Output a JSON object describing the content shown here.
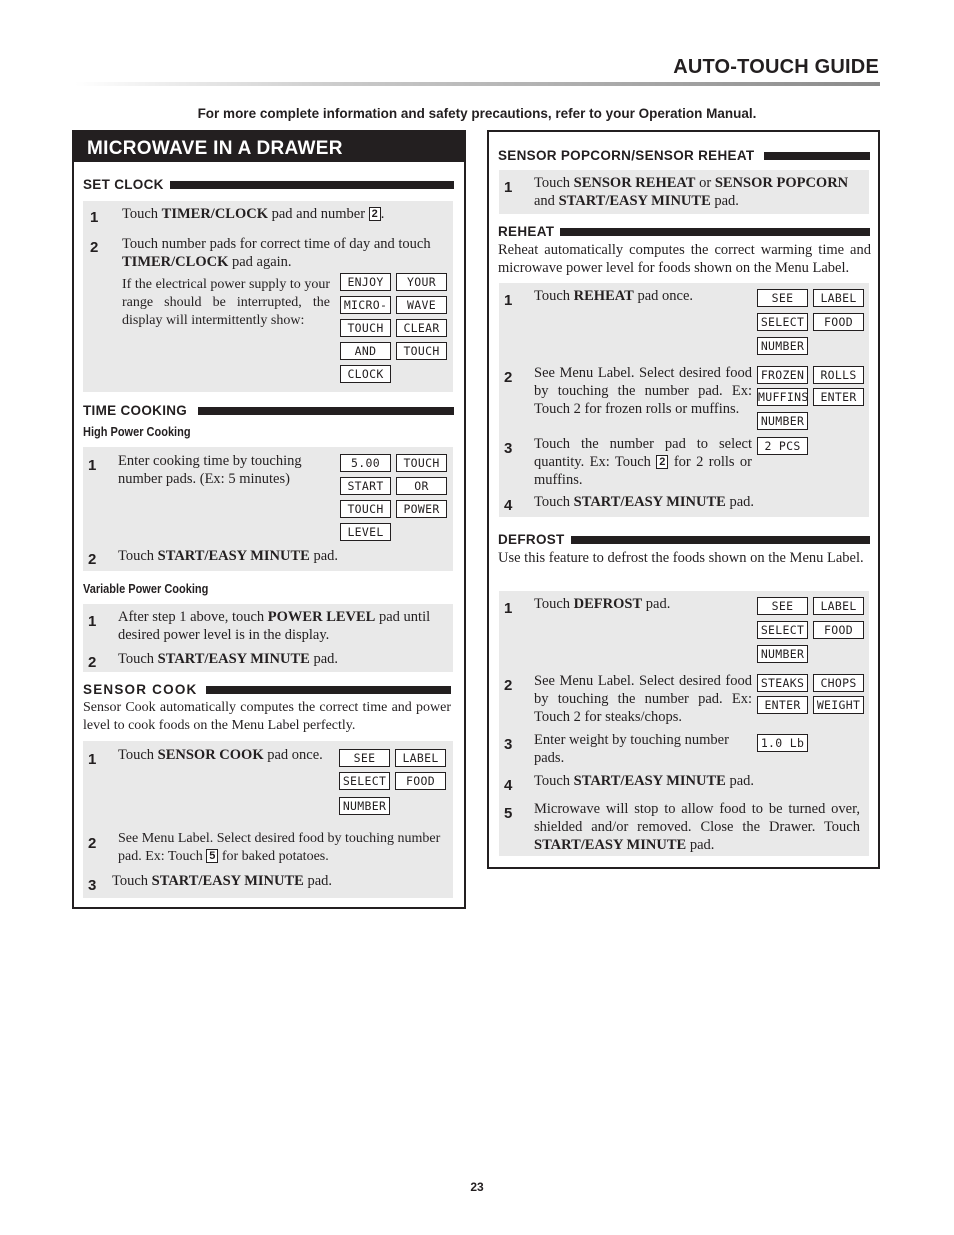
{
  "header": {
    "title": "AUTO-TOUCH GUIDE",
    "note": "For more complete information and safety precautions, refer to your Operation Manual."
  },
  "left": {
    "banner": "MICROWAVE IN A DRAWER",
    "set_clock": {
      "heading": "SET CLOCK",
      "steps": [
        {
          "num": "1",
          "pre": "Touch ",
          "bold": "TIMER/CLOCK",
          "post": " pad and number ",
          "key": "2",
          "tail": "."
        },
        {
          "num": "2",
          "pre": "Touch number pads for correct time of day and touch ",
          "bold": "TIMER/CLOCK",
          "post": " pad again."
        }
      ],
      "power_note": "If the electrical power supply to your range should be interrupted, the display will intermittently show:",
      "display": [
        "ENJOY",
        "YOUR",
        "MICRO-",
        "WAVE",
        "TOUCH",
        "CLEAR",
        "AND",
        "TOUCH",
        "CLOCK"
      ]
    },
    "time_cooking": {
      "heading": "TIME COOKING",
      "high_power": {
        "subheading": "High Power Cooking",
        "steps": [
          {
            "num": "1",
            "text": "Enter cooking time by touching number pads. (Ex: 5 minutes)"
          },
          {
            "num": "2",
            "pre": "Touch ",
            "bold": "START/EASY MINUTE",
            "post": " pad."
          }
        ],
        "display": [
          "5.00",
          "TOUCH",
          "START",
          "OR",
          "TOUCH",
          "POWER",
          "LEVEL"
        ]
      },
      "variable_power": {
        "subheading": "Variable Power Cooking",
        "steps": [
          {
            "num": "1",
            "pre": "After step 1 above, touch ",
            "bold": "POWER LEVEL",
            "post": " pad until desired power level is in the display."
          },
          {
            "num": "2",
            "pre": "Touch ",
            "bold": "START/EASY MINUTE",
            "post": " pad."
          }
        ]
      }
    },
    "sensor_cook": {
      "heading": "SENSOR COOK",
      "description": "Sensor Cook automatically computes the correct time and power level to cook foods on the Menu Label perfectly.",
      "steps": [
        {
          "num": "1",
          "pre": "Touch ",
          "bold": "SENSOR COOK",
          "post": " pad once."
        },
        {
          "num": "2",
          "pre": "See Menu Label. Select desired food by touching number pad. Ex: Touch ",
          "key": "5",
          "post": " for baked potatoes."
        },
        {
          "num": "3",
          "pre": "Touch ",
          "bold": "START/EASY MINUTE",
          "post": " pad."
        }
      ],
      "display": [
        "SEE",
        "LABEL",
        "SELECT",
        "FOOD",
        "NUMBER"
      ]
    }
  },
  "right": {
    "sensor_popcorn": {
      "heading": "SENSOR POPCORN/SENSOR REHEAT",
      "steps": [
        {
          "num": "1",
          "pre": "Touch ",
          "bold1": "SENSOR REHEAT",
          "mid": " or ",
          "bold2": "SENSOR POPCORN",
          "mid2": " and ",
          "bold3": "START/EASY MINUTE",
          "post": " pad."
        }
      ]
    },
    "reheat": {
      "heading": "REHEAT",
      "description": "Reheat automatically computes the correct warming time and microwave power level for foods shown on the Menu Label.",
      "steps": [
        {
          "num": "1",
          "pre": "Touch ",
          "bold": "REHEAT",
          "post": " pad once."
        },
        {
          "num": "2",
          "text": "See Menu Label. Select desired food by touching the number pad. Ex: Touch 2 for frozen rolls or muffins."
        },
        {
          "num": "3",
          "pre": "Touch the number pad to select quantity. Ex: Touch ",
          "key": "2",
          "post": " for 2 rolls or muffins."
        },
        {
          "num": "4",
          "pre": "Touch ",
          "bold": "START/EASY MINUTE",
          "post": " pad."
        }
      ],
      "display1": [
        "SEE",
        "LABEL",
        "SELECT",
        "FOOD",
        "NUMBER"
      ],
      "display2": [
        "FROZEN",
        "ROLLS",
        "MUFFINS",
        "ENTER",
        "NUMBER"
      ],
      "display3": [
        "2 PCS"
      ]
    },
    "defrost": {
      "heading": "DEFROST",
      "description": "Use this feature to defrost the foods shown on the Menu Label.",
      "steps": [
        {
          "num": "1",
          "pre": "Touch ",
          "bold": "DEFROST",
          "post": " pad."
        },
        {
          "num": "2",
          "text": "See Menu Label. Select desired food by touching the number pad. Ex: Touch 2 for steaks/chops."
        },
        {
          "num": "3",
          "text": "Enter weight by touching number pads."
        },
        {
          "num": "4",
          "pre": "Touch ",
          "bold": "START/EASY MINUTE",
          "post": " pad."
        },
        {
          "num": "5",
          "pre": "Microwave will stop to allow food to be turned over, shielded and/or removed. Close the Drawer. Touch ",
          "bold": "START/EASY MINUTE",
          "post": " pad."
        }
      ],
      "display1": [
        "SEE",
        "LABEL",
        "SELECT",
        "FOOD",
        "NUMBER"
      ],
      "display2": [
        "STEAKS",
        "CHOPS",
        "ENTER",
        "WEIGHT"
      ],
      "display3": [
        "1.0 Lb"
      ]
    }
  },
  "footer": {
    "page_number": "23"
  },
  "colors": {
    "ink": "#231f20",
    "panel": "#e9e9e9",
    "banner_text": "#ffffff"
  }
}
